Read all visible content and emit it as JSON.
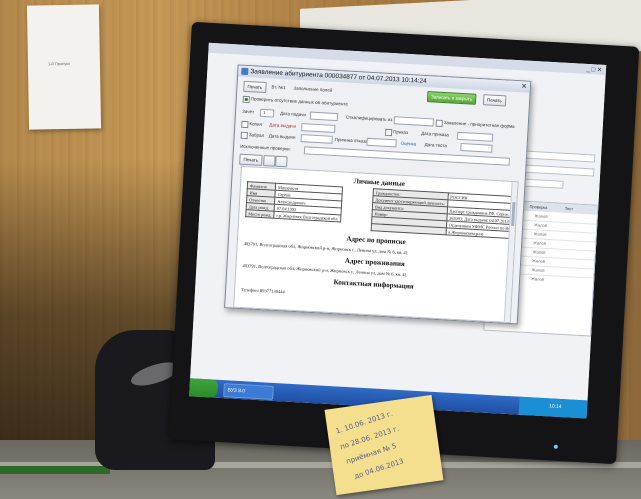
{
  "wall_note": {
    "text": "1-й Пропуск"
  },
  "dialog": {
    "title": "Заявление абитуриента 000034877 от 04.07.2013 10:14:24",
    "close_glyph": "✕",
    "toolbar": {
      "print_label": "Печать",
      "btn2_label": "Вт. №1",
      "btn3_label": "Заполнение полей",
      "save_close_label": "Записать и закрыть",
      "write_label": "Печать"
    },
    "form": {
      "check_label": "Проверить отсутствие данных об абитуриенте",
      "course_label": "Зачёт",
      "course_value": "1",
      "date_label": "Дата подачи",
      "zachislen_label": "Откалифицировать из",
      "zayavlenie_label": "Заявление - приоритетная форма",
      "vstup_label": "Копия",
      "date_doc_label": "Дата выдачи",
      "prinyat_label": "Приказ",
      "date_prikaz_label": "Дата приказа",
      "zabral_label": "Забрал",
      "date_zabral_label": "Дата выдачи",
      "prichina_label": "Причина отказа",
      "ocenka_label": "Оценка",
      "data_label": "Дата теста",
      "history_label": "Исключенные проверки:",
      "ok_label": "Печать"
    },
    "report": {
      "title_personal": "Личные данные",
      "rows_left": [
        {
          "k": "Фамилия",
          "v": "Мишечкин"
        },
        {
          "k": "Имя",
          "v": "Сергей"
        },
        {
          "k": "Отчество",
          "v": "Александрович"
        },
        {
          "k": "Дата рожд.",
          "v": "07.04.1993"
        },
        {
          "k": "Место рожд.",
          "v": "г.р. Жирновск Волгоградской обл."
        }
      ],
      "rows_right": [
        {
          "k": "Гражданство:",
          "v": "РОССИЯ"
        },
        {
          "k": "Документ удостоверяющий личность:",
          "v": ""
        },
        {
          "k": "Вид документа:",
          "v": "Паспорт гражданина РФ, Серия: 1813;"
        },
        {
          "k": "Номер:",
          "v": "365993; Дата выдачи: 04.07.2013; Кем выдан:"
        },
        {
          "k": "",
          "v": "Отделением УФМС России по Волгоградской области"
        },
        {
          "k": "",
          "v": "в Жирновском р-не"
        }
      ],
      "title_propiska": "Адрес по прописке",
      "propiska": "403791, Волгоградская обл, Жирновский р-н, Жирновск г., Ленина ул, дом № 6, кв. 41",
      "title_prozhiv": "Адрес проживания",
      "prozhiv": "403791, Волгоградская обл, Жирновский р-н, Жирновск г., Ленина ул, дом № 6, кв. 41",
      "title_contact": "Контактная информация",
      "phone": "Телефон: 89377130444"
    }
  },
  "background_app": {
    "grid_headers": [
      "Дата",
      "Проверка",
      "Тест"
    ],
    "grid_cells": [
      "Жалоб",
      "Жалоб",
      "Жалоб",
      "Жалоб",
      "Жалоб",
      "Жалоб",
      "Жалоб",
      "Жалоб"
    ],
    "win_controls": "_ □ ✕"
  },
  "taskbar": {
    "start_label": "",
    "task_label": "ВУЗ 8.0",
    "clock": "10:14"
  },
  "sticky_note": {
    "line1": "1. 10.06. 2013 г.",
    "line2": "по 28.06. 2013 г.",
    "line3": "приёмная № 5",
    "line4": "до 04.06.2013"
  },
  "colors": {
    "wall": "#b58a4d",
    "taskbar": "#2f6bc6",
    "start": "#3fa43c",
    "sticky": "#f4df8f"
  }
}
